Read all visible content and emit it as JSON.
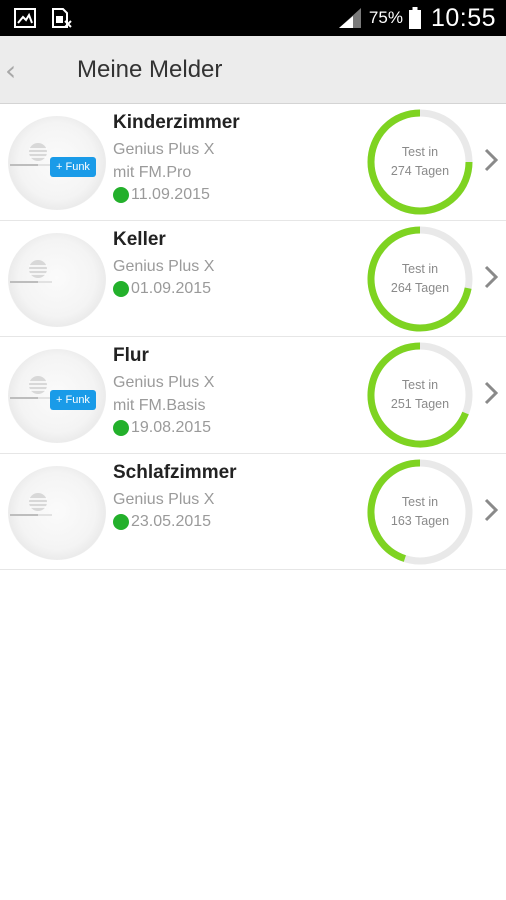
{
  "status_bar": {
    "icons": [
      "gallery-icon",
      "sim-card-x-icon"
    ],
    "battery": "75%",
    "time": "10:55"
  },
  "header": {
    "back_icon": "chevron-left-icon",
    "title": "Meine Melder"
  },
  "colors": {
    "ring": "#7ed321",
    "ring_track": "#e9e9e9",
    "status_dot": "#23b02b",
    "funk_badge": "#1a9be8"
  },
  "detectors": [
    {
      "name": "Kinderzimmer",
      "model": "Genius Plus X",
      "variant": "mit FM.Pro",
      "badge": "+ Funk",
      "date": "11.09.2015",
      "test_line1": "Test in",
      "test_line2": "274 Tagen",
      "progress": 0.75
    },
    {
      "name": "Keller",
      "model": "Genius Plus X",
      "variant": "",
      "badge": "",
      "date": "01.09.2015",
      "test_line1": "Test in",
      "test_line2": "264 Tagen",
      "progress": 0.72
    },
    {
      "name": "Flur",
      "model": "Genius Plus X",
      "variant": "mit FM.Basis",
      "badge": "+ Funk",
      "date": "19.08.2015",
      "test_line1": "Test in",
      "test_line2": "251 Tagen",
      "progress": 0.69
    },
    {
      "name": "Schlafzimmer",
      "model": "Genius Plus X",
      "variant": "",
      "badge": "",
      "date": "23.05.2015",
      "test_line1": "Test in",
      "test_line2": "163 Tagen",
      "progress": 0.45
    }
  ]
}
